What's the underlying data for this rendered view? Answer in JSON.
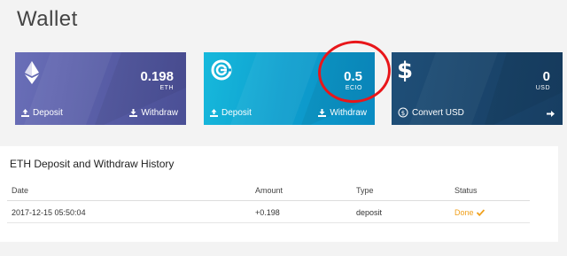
{
  "page": {
    "title": "Wallet"
  },
  "cards": [
    {
      "amount": "0.198",
      "unit": "ETH",
      "left_action": "Deposit",
      "right_action": "Withdraw",
      "color": "#5a5fa8"
    },
    {
      "amount": "0.5",
      "unit": "ECIO",
      "left_action": "Deposit",
      "right_action": "Withdraw",
      "color": "#0ea0cf"
    },
    {
      "amount": "0",
      "unit": "USD",
      "left_action": "Convert USD",
      "right_action": "",
      "color": "#1a456c"
    }
  ],
  "history": {
    "title": "ETH Deposit and Withdraw History",
    "columns": [
      "Date",
      "Amount",
      "Type",
      "Status"
    ],
    "rows": [
      {
        "date": "2017-12-15 05:50:04",
        "amount": "+0.198",
        "type": "deposit",
        "status": "Done",
        "status_color": "#f0a01c"
      }
    ]
  },
  "annotation": {
    "color": "#e8161a"
  }
}
